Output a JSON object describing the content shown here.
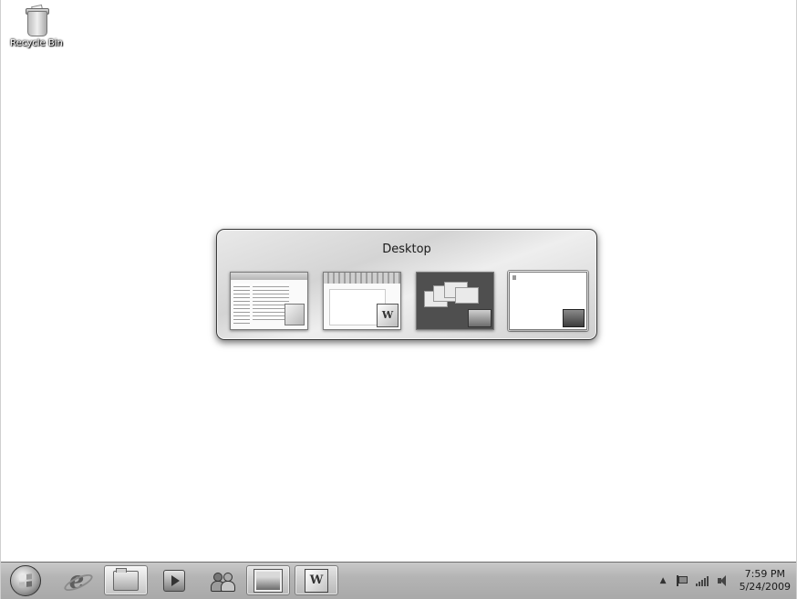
{
  "desktop": {
    "icons": [
      {
        "label": "Recycle Bin",
        "icon": "recycle-bin-icon"
      }
    ]
  },
  "switcher": {
    "title": "Desktop",
    "items": [
      {
        "name": "Windows Explorer",
        "icon": "explorer-window-icon",
        "selected": false
      },
      {
        "name": "Microsoft Word",
        "icon": "word-window-icon",
        "selected": false
      },
      {
        "name": "Flip",
        "icon": "flip-window-icon",
        "selected": false
      },
      {
        "name": "Desktop",
        "icon": "desktop-icon",
        "selected": true
      }
    ]
  },
  "taskbar": {
    "buttons": [
      {
        "name": "start-button",
        "icon": "windows-logo-icon"
      },
      {
        "name": "internet-explorer",
        "icon": "internet-explorer-icon"
      },
      {
        "name": "windows-explorer",
        "icon": "folder-icon",
        "active": true
      },
      {
        "name": "media-player",
        "icon": "media-player-icon"
      },
      {
        "name": "messenger",
        "icon": "people-icon"
      },
      {
        "name": "photo-gallery",
        "icon": "photo-icon"
      },
      {
        "name": "word",
        "icon": "word-icon",
        "glyph": "W"
      }
    ],
    "tray": {
      "icons": [
        "show-hidden-icons-icon",
        "action-center-flag-icon",
        "network-signal-icon",
        "volume-icon"
      ],
      "time": "7:59 PM",
      "date": "5/24/2009"
    }
  }
}
